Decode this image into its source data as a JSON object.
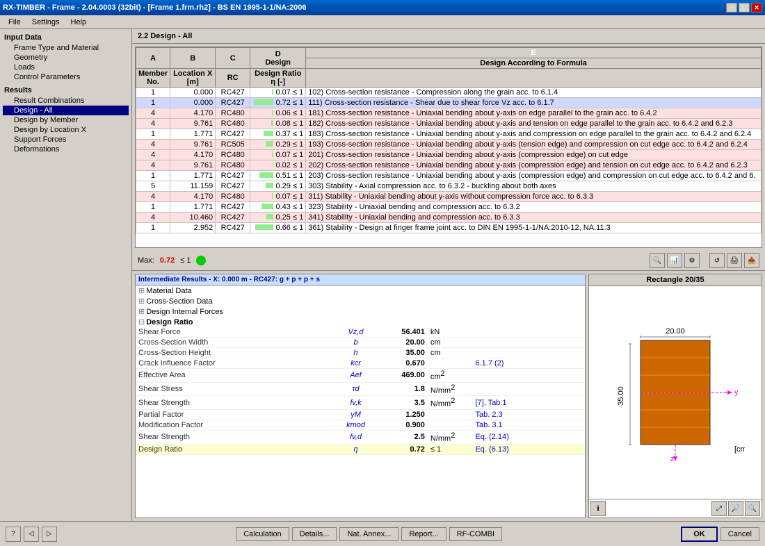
{
  "window": {
    "title": "RX-TIMBER - Frame - 2.04.0003 (32bit) - [Frame 1.frm.rh2] - BS EN 1995-1-1/NA:2006"
  },
  "menu": {
    "items": [
      "File",
      "Settings",
      "Help"
    ]
  },
  "sidebar": {
    "inputDataLabel": "Input Data",
    "items": [
      {
        "id": "frame-type",
        "label": "Frame Type and Material",
        "level": 1
      },
      {
        "id": "geometry",
        "label": "Geometry",
        "level": 1
      },
      {
        "id": "loads",
        "label": "Loads",
        "level": 1
      },
      {
        "id": "control-params",
        "label": "Control Parameters",
        "level": 1
      }
    ],
    "resultsLabel": "Results",
    "resultItems": [
      {
        "id": "result-combos",
        "label": "Result Combinations",
        "level": 1
      },
      {
        "id": "design-all",
        "label": "Design - All",
        "level": 1,
        "active": true
      },
      {
        "id": "design-by-member",
        "label": "Design by Member",
        "level": 1
      },
      {
        "id": "design-by-location",
        "label": "Design by Location X",
        "level": 1
      },
      {
        "id": "support-forces",
        "label": "Support Forces",
        "level": 1
      },
      {
        "id": "deformations",
        "label": "Deformations",
        "level": 1
      }
    ]
  },
  "main": {
    "sectionTitle": "2.2 Design - All",
    "tableColumns": [
      "Member No.",
      "Location X [m]",
      "RC",
      "Design Ratio η [-]",
      "Design According to Formula"
    ],
    "colHeaders": [
      "A",
      "B",
      "C",
      "D",
      "E"
    ],
    "rows": [
      {
        "member": "1",
        "location": "0.000",
        "rc": "RC427",
        "ratio": "0.07",
        "le1": "≤ 1",
        "bar": 7,
        "formula": "102) Cross-section resistance - Compression along the grain acc. to 6.1.4",
        "class": "row-normal"
      },
      {
        "member": "1",
        "location": "0.000",
        "rc": "RC427",
        "ratio": "0.72",
        "le1": "≤ 1",
        "bar": 72,
        "formula": "111) Cross-section resistance - Shear due to shear force Vz acc. to 6.1.7",
        "class": "row-blue"
      },
      {
        "member": "4",
        "location": "4.170",
        "rc": "RC480",
        "ratio": "0.06",
        "le1": "≤ 1",
        "bar": 6,
        "formula": "181) Cross-section resistance - Uniaxial bending about y-axis on edge parallel to the grain acc. to 6.4.2",
        "class": "row-highlight"
      },
      {
        "member": "4",
        "location": "9.761",
        "rc": "RC480",
        "ratio": "0.08",
        "le1": "≤ 1",
        "bar": 8,
        "formula": "182) Cross-section resistance - Uniaxial bending about y-axis and tension on edge parallel to the grain acc. to 6.4.2 and 6.2.3",
        "class": "row-highlight"
      },
      {
        "member": "1",
        "location": "1.771",
        "rc": "RC427",
        "ratio": "0.37",
        "le1": "≤ 1",
        "bar": 37,
        "formula": "183) Cross-section resistance - Uniaxial bending about y-axis and compression on edge parallel to the grain acc. to 6.4.2 and 6.2.4",
        "class": "row-normal"
      },
      {
        "member": "4",
        "location": "9.761",
        "rc": "RC505",
        "ratio": "0.29",
        "le1": "≤ 1",
        "bar": 29,
        "formula": "193) Cross-section resistance - Uniaxial bending about y-axis (tension edge) and compression on cut edge acc. to 6.4.2 and 6.2.4",
        "class": "row-highlight"
      },
      {
        "member": "4",
        "location": "4.170",
        "rc": "RC480",
        "ratio": "0.07",
        "le1": "≤ 1",
        "bar": 7,
        "formula": "201) Cross-section resistance - Uniaxial bending about y-axis (compression edge) on cut edge",
        "class": "row-highlight"
      },
      {
        "member": "4",
        "location": "9.761",
        "rc": "RC480",
        "ratio": "0.02",
        "le1": "≤ 1",
        "bar": 2,
        "formula": "202) Cross-section resistance - Uniaxial bending about y-axis (compression edge) and tension on cut edge acc. to 6.4.2 and 6.2.3",
        "class": "row-highlight"
      },
      {
        "member": "1",
        "location": "1.771",
        "rc": "RC427",
        "ratio": "0.51",
        "le1": "≤ 1",
        "bar": 51,
        "formula": "203) Cross-section resistance - Uniaxial bending about y-axis (compression edge) and compression on cut edge acc. to 6.4.2 and 6.",
        "class": "row-normal"
      },
      {
        "member": "5",
        "location": "11.159",
        "rc": "RC427",
        "ratio": "0.29",
        "le1": "≤ 1",
        "bar": 29,
        "formula": "303) Stability - Axial compression acc. to 6.3.2 - buckling about both axes",
        "class": "row-normal"
      },
      {
        "member": "4",
        "location": "4.170",
        "rc": "RC480",
        "ratio": "0.07",
        "le1": "≤ 1",
        "bar": 7,
        "formula": "311) Stability - Uniaxial bending about y-axis without compression force acc. to 6.3.3",
        "class": "row-highlight"
      },
      {
        "member": "1",
        "location": "1.771",
        "rc": "RC427",
        "ratio": "0.43",
        "le1": "≤ 1",
        "bar": 43,
        "formula": "323) Stability - Uniaxial bending and compression acc. to 6.3.2",
        "class": "row-normal"
      },
      {
        "member": "4",
        "location": "10.460",
        "rc": "RC427",
        "ratio": "0.25",
        "le1": "≤ 1",
        "bar": 25,
        "formula": "341) Stability - Uniaxial bending and compression acc. to 6.3.3",
        "class": "row-highlight"
      },
      {
        "member": "1",
        "location": "2.952",
        "rc": "RC427",
        "ratio": "0.66",
        "le1": "≤ 1",
        "bar": 66,
        "formula": "361) Stability - Design at finger frame joint acc. to DIN EN 1995-1-1/NA:2010-12, NA.11.3",
        "class": "row-normal"
      }
    ],
    "maxLabel": "Max:",
    "maxValue": "0.72",
    "maxLe1": "≤ 1"
  },
  "intermediate": {
    "headerText": "Intermediate Results  -  X: 0.000 m  -  RC427: g + p + p + s",
    "sections": [
      {
        "label": "Material Data",
        "expanded": false
      },
      {
        "label": "Cross-Section Data",
        "expanded": false
      },
      {
        "label": "Design Internal Forces",
        "expanded": false
      },
      {
        "label": "Design Ratio",
        "expanded": true
      }
    ],
    "details": [
      {
        "label": "Shear Force",
        "sym": "Vz,d",
        "val": "56.401",
        "unit": "kN",
        "ref": ""
      },
      {
        "label": "Cross-Section Width",
        "sym": "b",
        "val": "20.00",
        "unit": "cm",
        "ref": ""
      },
      {
        "label": "Cross-Section Height",
        "sym": "h",
        "val": "35.00",
        "unit": "cm",
        "ref": ""
      },
      {
        "label": "Crack Influence Factor",
        "sym": "kcr",
        "val": "0.670",
        "unit": "",
        "ref": "6.1.7 (2)"
      },
      {
        "label": "Effective Area",
        "sym": "Aef",
        "val": "469.00",
        "unit": "cm²",
        "ref": ""
      },
      {
        "label": "Shear Stress",
        "sym": "τd",
        "val": "1.8",
        "unit": "N/mm²",
        "ref": ""
      },
      {
        "label": "Shear Strength",
        "sym": "fv,k",
        "val": "3.5",
        "unit": "N/mm²",
        "ref": "[7], Tab.1"
      },
      {
        "label": "Partial Factor",
        "sym": "γM",
        "val": "1.250",
        "unit": "",
        "ref": "Tab. 2.3"
      },
      {
        "label": "Modification Factor",
        "sym": "kmod",
        "val": "0.900",
        "unit": "",
        "ref": "Tab. 3.1"
      },
      {
        "label": "Shear Strength",
        "sym": "fv,d",
        "val": "2.5",
        "unit": "N/mm²",
        "ref": "Eq. (2.14)"
      },
      {
        "label": "Design Ratio",
        "sym": "η",
        "val": "0.72",
        "unit": "≤ 1",
        "ref": "Eq. (6.13)",
        "highlight": true
      }
    ]
  },
  "rectangle": {
    "title": "Rectangle 20/35",
    "width": "20.00",
    "height": "35.00",
    "unit": "[cm]"
  },
  "toolbar": {
    "calcLabel": "Calculation",
    "detailsLabel": "Details...",
    "natAnnexLabel": "Nat. Annex...",
    "reportLabel": "Report...",
    "rfCombiLabel": "RF-COMBI",
    "okLabel": "OK",
    "cancelLabel": "Cancel"
  }
}
